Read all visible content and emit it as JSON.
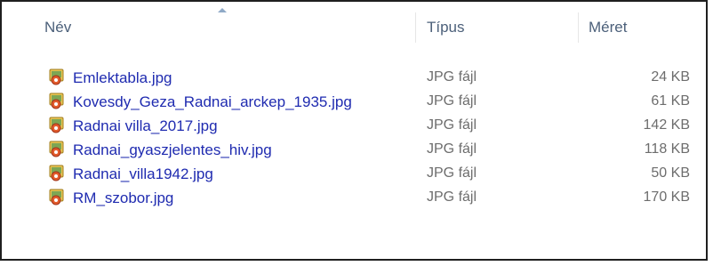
{
  "header": {
    "columns": {
      "name": "Név",
      "type": "Típus",
      "size": "Méret"
    }
  },
  "files": [
    {
      "name": "Emlektabla.jpg",
      "type": "JPG fájl",
      "size": "24 KB",
      "icon": "jpg-file-icon"
    },
    {
      "name": "Kovesdy_Geza_Radnai_arckep_1935.jpg",
      "type": "JPG fájl",
      "size": "61 KB",
      "icon": "jpg-file-icon"
    },
    {
      "name": "Radnai villa_2017.jpg",
      "type": "JPG fájl",
      "size": "142 KB",
      "icon": "jpg-file-icon"
    },
    {
      "name": "Radnai_gyaszjelentes_hiv.jpg",
      "type": "JPG fájl",
      "size": "118 KB",
      "icon": "jpg-file-icon"
    },
    {
      "name": "Radnai_villa1942.jpg",
      "type": "JPG fájl",
      "size": "50 KB",
      "icon": "jpg-file-icon"
    },
    {
      "name": "RM_szobor.jpg",
      "type": "JPG fájl",
      "size": "170 KB",
      "icon": "jpg-file-icon"
    }
  ],
  "colors": {
    "link": "#1f2bb0",
    "header_text": "#4c607a",
    "muted": "#6d6d6d",
    "frame_border": "#1f1f1f"
  }
}
